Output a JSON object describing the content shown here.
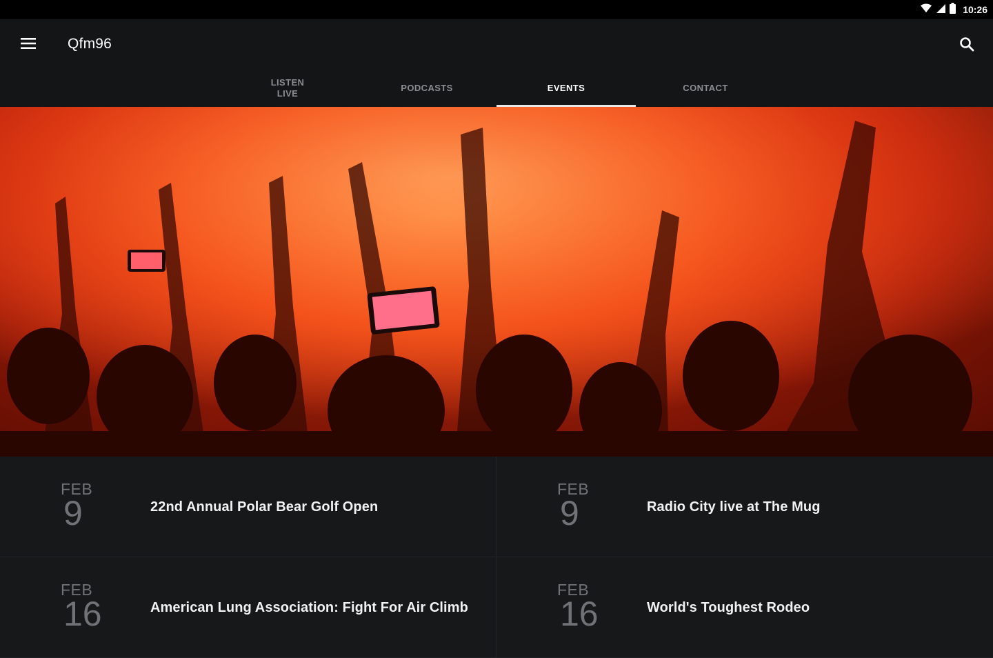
{
  "status_bar": {
    "time": "10:26",
    "icons": [
      "wifi-icon",
      "cell-signal-icon",
      "battery-icon"
    ]
  },
  "app_bar": {
    "title": "Qfm96",
    "menu_icon": "hamburger-menu-icon",
    "search_icon": "search-icon"
  },
  "tabs": [
    {
      "label": "LISTEN\nLIVE",
      "active": false
    },
    {
      "label": "PODCASTS",
      "active": false
    },
    {
      "label": "EVENTS",
      "active": true
    },
    {
      "label": "CONTACT",
      "active": false
    }
  ],
  "events": [
    {
      "month": "FEB",
      "day": "9",
      "title": "22nd Annual Polar Bear Golf Open"
    },
    {
      "month": "FEB",
      "day": "9",
      "title": "Radio City live at The Mug"
    },
    {
      "month": "FEB",
      "day": "16",
      "title": "American Lung Association: Fight For Air Climb"
    },
    {
      "month": "FEB",
      "day": "16",
      "title": "World's Toughest Rodeo"
    }
  ],
  "colors": {
    "background": "#141517",
    "tab_active": "#ffffff",
    "tab_inactive": "#8b8d90",
    "date_text": "#6f7276",
    "hero_accent": "#f2511a"
  }
}
